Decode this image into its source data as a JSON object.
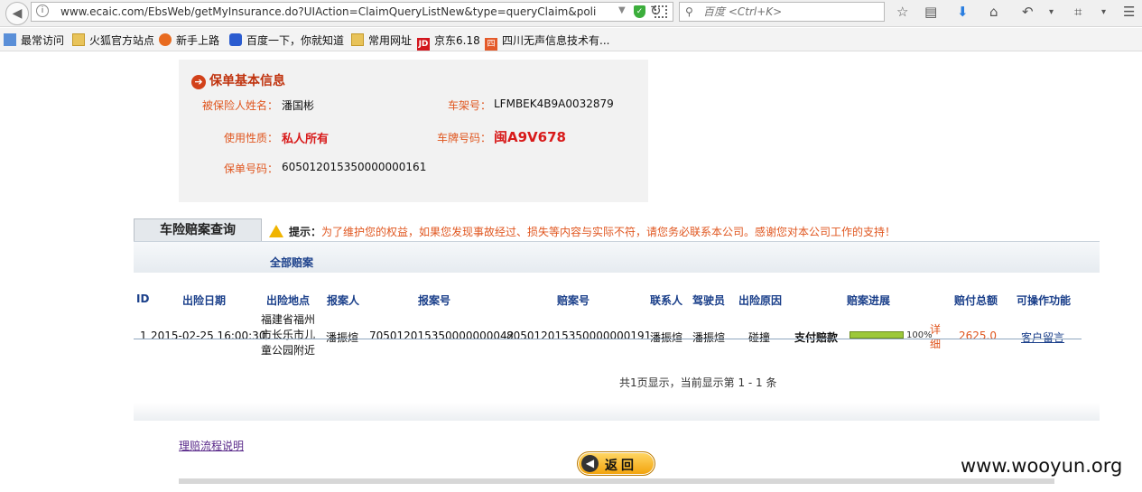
{
  "browser": {
    "url": "www.ecaic.com/EbsWeb/getMyInsurance.do?UIAction=ClaimQueryListNew&type=queryClaim&poli",
    "search_placeholder": "百度 <Ctrl+K>"
  },
  "bookmarks": [
    {
      "label": "最常访问",
      "icon": "bookmark-icon"
    },
    {
      "label": "火狐官方站点",
      "icon": "folder-icon"
    },
    {
      "label": "新手上路",
      "icon": "firefox-icon"
    },
    {
      "label": "百度一下，你就知道",
      "icon": "baidu-paw-icon"
    },
    {
      "label": "常用网址",
      "icon": "folder-icon"
    },
    {
      "label": "京东6.18",
      "icon": "jd-icon",
      "icon_text": "JD"
    },
    {
      "label": "四川无声信息技术有...",
      "icon": "site-icon",
      "icon_text": "四"
    }
  ],
  "policy": {
    "heading": "保单基本信息",
    "insured_name_label": "被保险人姓名：",
    "insured_name": "潘国彬",
    "vin_label": "车架号：",
    "vin": "LFMBEK4B9A0032879",
    "usage_label": "使用性质：",
    "usage": "私人所有",
    "plate_label": "车牌号码：",
    "plate": "闽A9V678",
    "policy_no_label": "保单号码：",
    "policy_no": "605012015350000000161"
  },
  "tabs": {
    "main_tab": "车险赔案查询",
    "sub_tab": "全部赔案"
  },
  "tip": {
    "label": "提示：",
    "text": "为了维护您的权益，如果您发现事故经过、损失等内容与实际不符，请您务必联系本公司。感谢您对本公司工作的支持！"
  },
  "table": {
    "headers": [
      "ID",
      "出险日期",
      "出险地点",
      "报案人",
      "报案号",
      "赔案号",
      "联系人",
      "驾驶员",
      "出险原因",
      "赔案进展",
      "赔付总额",
      "可操作功能"
    ],
    "rows": [
      {
        "id": "1",
        "date": "2015-02-25 16:00:30",
        "location": "福建省福州市长乐市儿童公园附近",
        "reporter": "潘振煊",
        "report_no": "705012015350000000042",
        "claim_no": "805012015350000000191",
        "contact": "潘振煊",
        "driver": "潘振煊",
        "cause": "碰撞",
        "progress_text": "支付赔款",
        "progress_percent": "100%",
        "progress_value": 100,
        "detail_link": "详细",
        "amount": "2625.0",
        "action": "客户留言"
      }
    ],
    "pager": "共1页显示，当前显示第 1 - 1 条"
  },
  "footer": {
    "process_link": "理赔流程说明",
    "back_button": "返回"
  },
  "watermark": "www.wooyun.org"
}
